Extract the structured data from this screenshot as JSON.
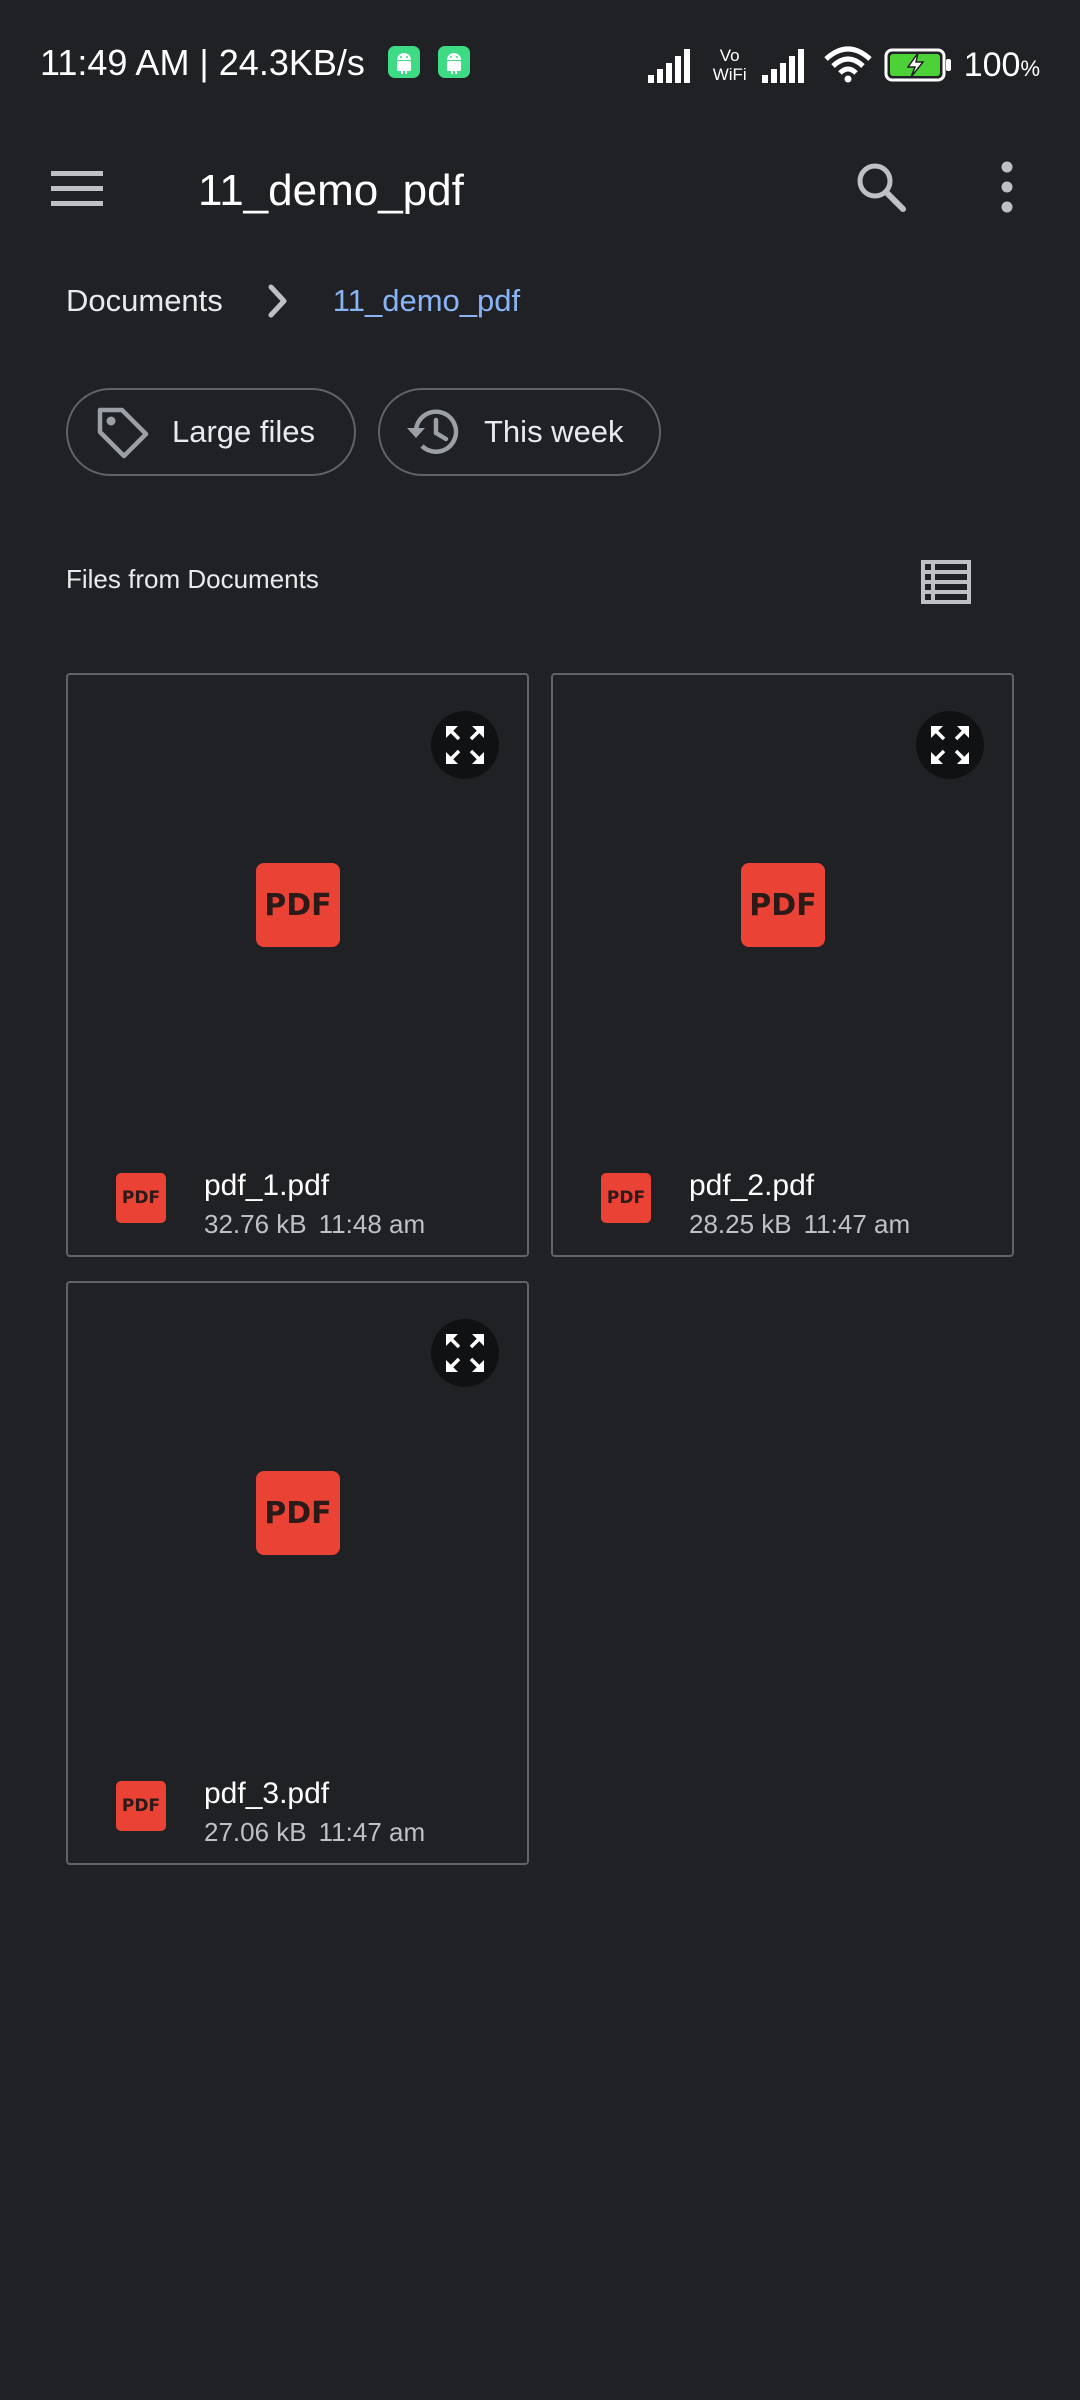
{
  "status_bar": {
    "time_speed": "11:49 AM | 24.3KB/s",
    "vowifi_line1": "Vo",
    "vowifi_line2": "WiFi",
    "battery_percent": "100",
    "battery_unit": "%",
    "battery_level": 1.0
  },
  "appbar": {
    "title": "11_demo_pdf"
  },
  "breadcrumb": {
    "items": [
      "Documents",
      "11_demo_pdf"
    ]
  },
  "chips": [
    {
      "label": "Large files",
      "icon": "tag-icon"
    },
    {
      "label": "This week",
      "icon": "history-icon"
    }
  ],
  "section": {
    "title": "Files from Documents"
  },
  "files": [
    {
      "name": "pdf_1.pdf",
      "size": "32.76 kB",
      "time": "11:48 am",
      "thumb_label": "PDF",
      "icon_label": "PDF"
    },
    {
      "name": "pdf_2.pdf",
      "size": "28.25 kB",
      "time": "11:47 am",
      "thumb_label": "PDF",
      "icon_label": "PDF"
    },
    {
      "name": "pdf_3.pdf",
      "size": "27.06 kB",
      "time": "11:47 am",
      "thumb_label": "PDF",
      "icon_label": "PDF"
    }
  ],
  "colors": {
    "background": "#202124",
    "accent": "#8ab4f8",
    "pdf_red": "#ea4335",
    "battery_green": "#4cd137"
  }
}
